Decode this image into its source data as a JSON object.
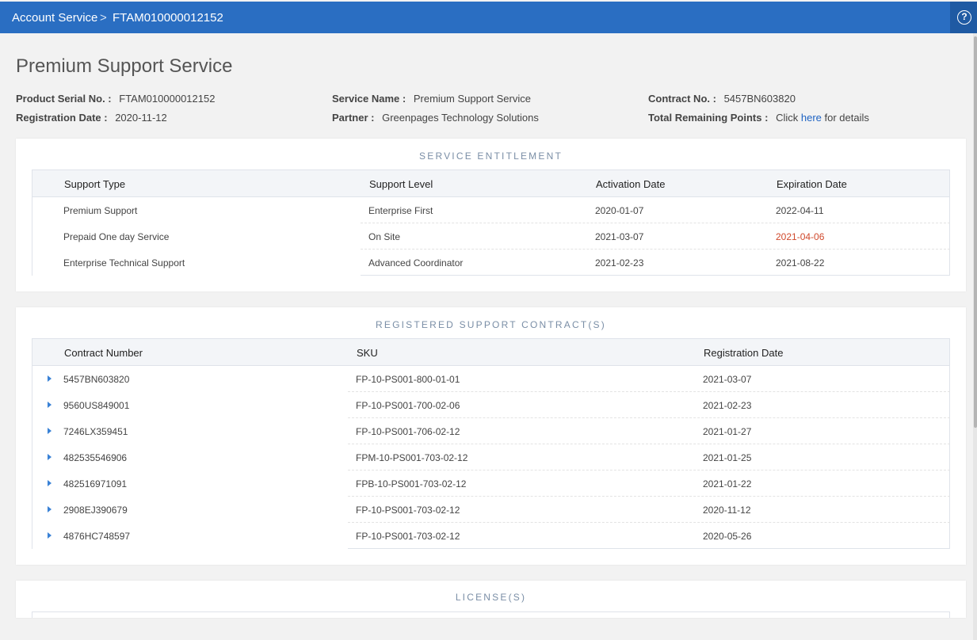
{
  "breadcrumb": {
    "root": "Account Service",
    "separator": ">",
    "current": "FTAM010000012152"
  },
  "help_icon_glyph": "?",
  "page_title": "Premium Support Service",
  "info": {
    "product_serial_label": "Product Serial No. :",
    "product_serial_value": "FTAM010000012152",
    "registration_date_label": "Registration Date :",
    "registration_date_value": "2020-11-12",
    "service_name_label": "Service Name :",
    "service_name_value": "Premium Support Service",
    "partner_label": "Partner :",
    "partner_value": "Greenpages Technology Solutions",
    "contract_no_label": "Contract No. :",
    "contract_no_value": "5457BN603820",
    "remaining_points_label": "Total Remaining Points :",
    "remaining_points_prefix": "Click",
    "remaining_points_link": "here",
    "remaining_points_suffix": "for details"
  },
  "entitlement": {
    "title": "SERVICE ENTITLEMENT",
    "headers": [
      "Support Type",
      "Support Level",
      "Activation Date",
      "Expiration Date"
    ],
    "rows": [
      [
        "Premium Support",
        "Enterprise First",
        "2020-01-07",
        "2022-04-11"
      ],
      [
        "Prepaid One day Service",
        "On Site",
        "2021-03-07",
        "2021-04-06"
      ],
      [
        "Enterprise Technical Support",
        "Advanced Coordinator",
        "2021-02-23",
        "2021-08-22"
      ]
    ]
  },
  "contracts": {
    "title": "REGISTERED SUPPORT CONTRACT(S)",
    "headers": [
      "Contract Number",
      "SKU",
      "Registration Date"
    ],
    "rows": [
      [
        "5457BN603820",
        "FP-10-PS001-800-01-01",
        "2021-03-07"
      ],
      [
        "9560US849001",
        "FP-10-PS001-700-02-06",
        "2021-02-23"
      ],
      [
        "7246LX359451",
        "FP-10-PS001-706-02-12",
        "2021-01-27"
      ],
      [
        "482535546906",
        "FPM-10-PS001-703-02-12",
        "2021-01-25"
      ],
      [
        "482516971091",
        "FPB-10-PS001-703-02-12",
        "2021-01-22"
      ],
      [
        "2908EJ390679",
        "FP-10-PS001-703-02-12",
        "2020-11-12"
      ],
      [
        "4876HC748597",
        "FP-10-PS001-703-02-12",
        "2020-05-26"
      ]
    ]
  },
  "licenses": {
    "title": "LICENSE(S)"
  },
  "colors": {
    "topbar": "#2a6ec2",
    "link": "#1e63c3",
    "expired_warning": "#d0492c",
    "caret": "#3a82d6"
  }
}
